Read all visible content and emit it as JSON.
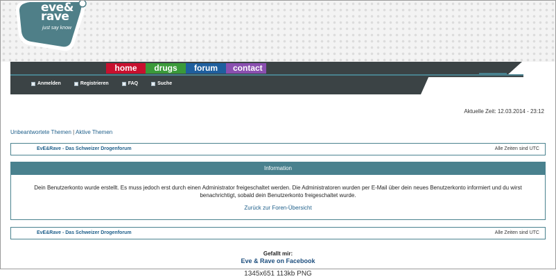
{
  "brand": {
    "logo_line1": "eve&",
    "logo_line2": "rave",
    "tagline": "just say know",
    "logo_color": "#4f7f88"
  },
  "nav": {
    "tabs": [
      {
        "label": "home",
        "color": "#c8102e"
      },
      {
        "label": "drugs",
        "color": "#3a9a3a"
      },
      {
        "label": "forum",
        "color": "#1e5f9e"
      },
      {
        "label": "contact",
        "color": "#8a4fb0"
      }
    ]
  },
  "subnav": {
    "items": [
      {
        "label": "Anmelden",
        "icon": "login-icon"
      },
      {
        "label": "Registrieren",
        "icon": "register-icon"
      },
      {
        "label": "FAQ",
        "icon": "faq-icon"
      },
      {
        "label": "Suche",
        "icon": "search-icon"
      }
    ]
  },
  "status": {
    "current_time": "Aktuelle Zeit: 12.03.2014 - 23:12"
  },
  "quick_links": {
    "unanswered": "Unbeantwortete Themen",
    "separator": "|",
    "active": "Aktive Themen"
  },
  "forum_bar": {
    "title": "EvE&Rave - Das Schweizer Drogenforum",
    "timezone": "Alle Zeiten sind UTC"
  },
  "info": {
    "heading": "Information",
    "message": "Dein Benutzerkonto wurde erstellt. Es muss jedoch erst durch einen Administrator freigeschaltet werden. Die Administratoren wurden per E-Mail über dein neues Benutzerkonto informiert und du wirst benachrichtigt, sobald dein Benutzerkonto freigeschaltet wurde.",
    "back_link": "Zurück zur Foren-Übersicht"
  },
  "social": {
    "label": "Gefallt mir:",
    "link": "Eve & Rave on Facebook"
  },
  "image_caption": "1345x651 113kb PNG"
}
